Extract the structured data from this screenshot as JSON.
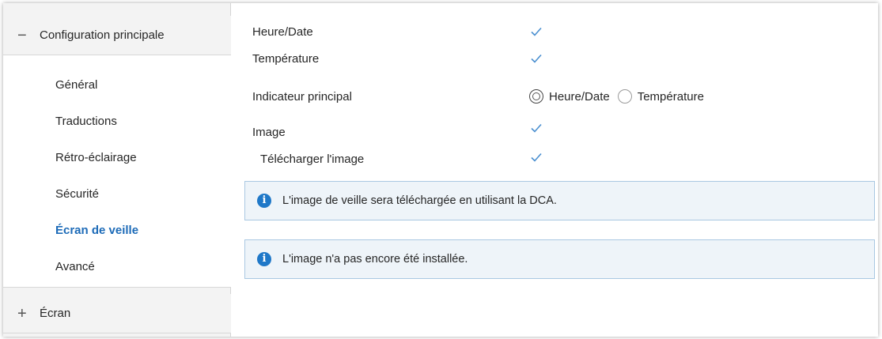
{
  "sidebar": {
    "main_group": {
      "toggle": "−",
      "label": "Configuration principale"
    },
    "items": [
      {
        "label": "Général"
      },
      {
        "label": "Traductions"
      },
      {
        "label": "Rétro-éclairage"
      },
      {
        "label": "Sécurité"
      },
      {
        "label": "Écran de veille",
        "active": true
      },
      {
        "label": "Avancé"
      }
    ],
    "screen_group": {
      "toggle": "+",
      "label": "Écran"
    }
  },
  "settings": {
    "heure_date": {
      "label": "Heure/Date",
      "checked": true
    },
    "temperature": {
      "label": "Température",
      "checked": true
    },
    "indicateur": {
      "label": "Indicateur principal",
      "options": [
        "Heure/Date",
        "Température"
      ],
      "selected": "Heure/Date"
    },
    "image": {
      "label": "Image",
      "checked": true
    },
    "telecharger": {
      "label": "Télécharger l'image",
      "checked": true
    }
  },
  "infos": [
    {
      "icon": "info-icon",
      "text": "L'image de veille sera téléchargée en utilisant la DCA."
    },
    {
      "icon": "info-icon",
      "text": "L'image n'a pas encore été installée."
    }
  ],
  "colors": {
    "accent": "#1d6bb8",
    "info_bg": "#eef4f9",
    "info_border": "#a9c8e2",
    "info_icon": "#1f78c8",
    "checkmark": "#4a8fd0"
  }
}
